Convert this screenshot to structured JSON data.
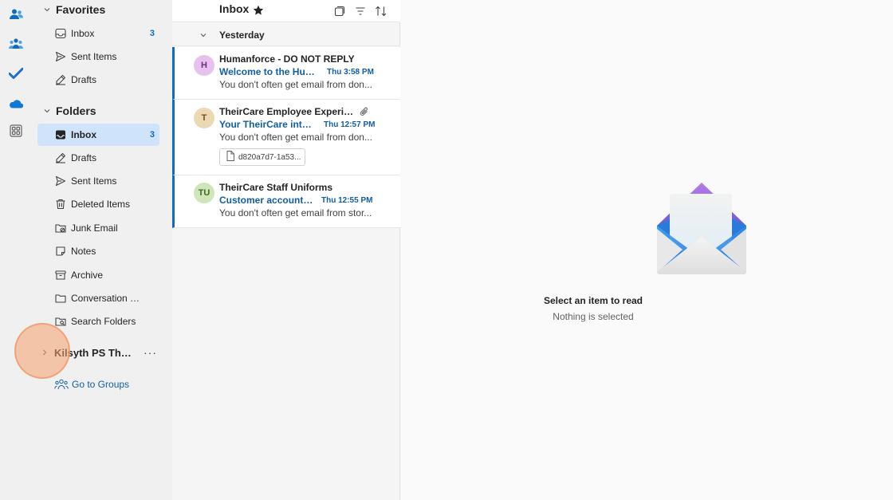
{
  "rail": {
    "items": [
      {
        "icon": "people-icon",
        "label": "People"
      },
      {
        "icon": "groups-icon",
        "label": "Groups"
      },
      {
        "icon": "todo-check-icon",
        "label": "To Do"
      },
      {
        "icon": "onedrive-cloud-icon",
        "label": "OneDrive"
      },
      {
        "icon": "apps-grid-icon",
        "label": "Apps"
      }
    ]
  },
  "favorites": {
    "title": "Favorites",
    "items": [
      {
        "label": "Inbox",
        "count": "3",
        "icon": "inbox-icon"
      },
      {
        "label": "Sent Items",
        "count": "",
        "icon": "send-icon"
      },
      {
        "label": "Drafts",
        "count": "",
        "icon": "drafts-icon"
      }
    ]
  },
  "folders": {
    "title": "Folders",
    "items": [
      {
        "label": "Inbox",
        "count": "3",
        "icon": "inbox-icon",
        "selected": true
      },
      {
        "label": "Drafts",
        "count": "",
        "icon": "drafts-icon"
      },
      {
        "label": "Sent Items",
        "count": "",
        "icon": "send-icon"
      },
      {
        "label": "Deleted Items",
        "count": "",
        "icon": "trash-icon"
      },
      {
        "label": "Junk Email",
        "count": "",
        "icon": "junk-folder-icon"
      },
      {
        "label": "Notes",
        "count": "",
        "icon": "notes-icon"
      },
      {
        "label": "Archive",
        "count": "",
        "icon": "archive-icon"
      },
      {
        "label": "Conversation Histo...",
        "count": "",
        "icon": "folder-icon"
      },
      {
        "label": "Search Folders",
        "count": "",
        "icon": "search-folder-icon"
      }
    ]
  },
  "group": {
    "label": "Kilsyth PS The...",
    "more": "···"
  },
  "goto_groups": "Go to Groups",
  "list": {
    "title": "Inbox",
    "group_header": "Yesterday",
    "messages": [
      {
        "avatar_initials": "H",
        "avatar_bg": "#e8c1f0",
        "avatar_fg": "#6b2d86",
        "sender": "Humanforce - DO NOT REPLY",
        "subject": "Welcome to the Hum...",
        "time": "Thu 3:58 PM",
        "preview": "You don't often get email from don..."
      },
      {
        "avatar_initials": "T",
        "avatar_bg": "#ead9b3",
        "avatar_fg": "#6b5220",
        "sender": "TheirCare Employee Experien...",
        "subject": "Your TheirCare intelli...",
        "time": "Thu 12:57 PM",
        "preview": "You don't often get email from don...",
        "attachment": "d820a7d7-1a53..."
      },
      {
        "avatar_initials": "TU",
        "avatar_bg": "#cfe6b8",
        "avatar_fg": "#3f6b1f",
        "sender": "TheirCare Staff Uniforms",
        "subject": "Customer account ac...",
        "time": "Thu 12:55 PM",
        "preview": "You don't often get email from stor..."
      }
    ]
  },
  "reading": {
    "title": "Select an item to read",
    "subtitle": "Nothing is selected"
  },
  "colors": {
    "accent": "#0f6cbd",
    "selected_bg": "#cfe4fa"
  }
}
